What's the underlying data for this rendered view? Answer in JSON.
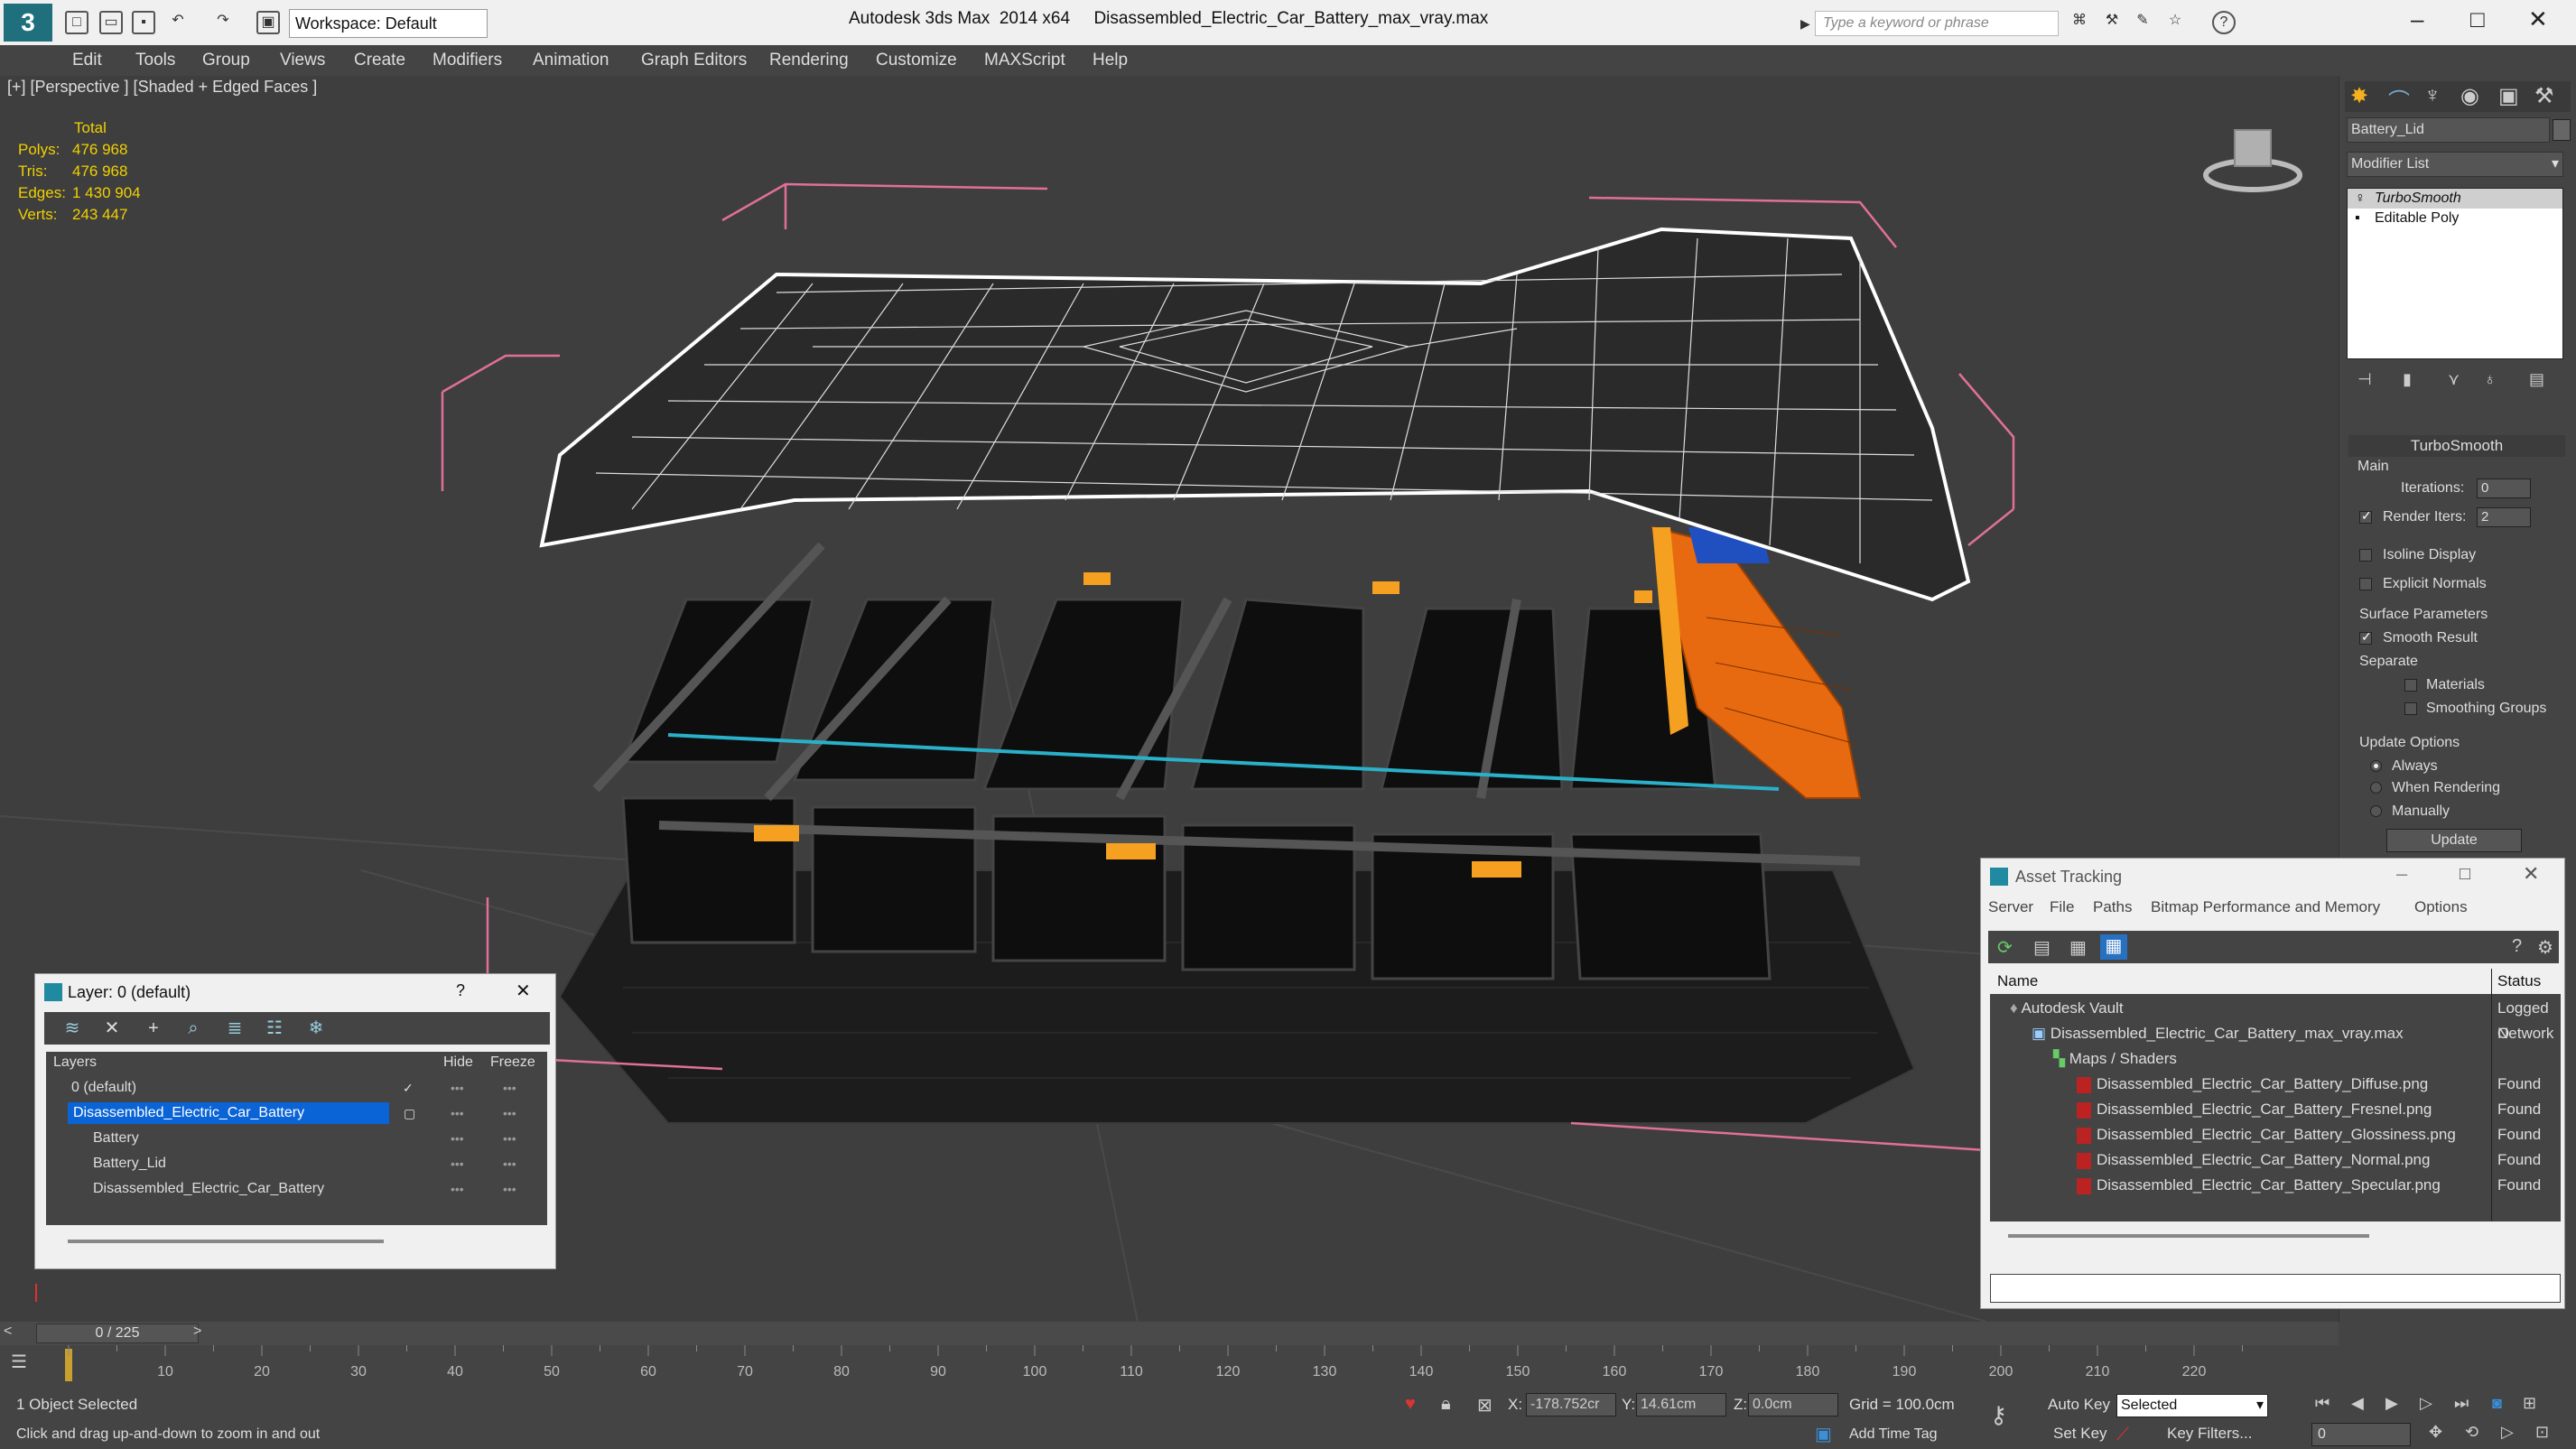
{
  "titlebar": {
    "app_logo": "3",
    "workspace": "Workspace: Default",
    "app_name": "Autodesk 3ds Max  2014 x64",
    "file_name": "Disassembled_Electric_Car_Battery_max_vray.max",
    "search_placeholder": "Type a keyword or phrase"
  },
  "menu": [
    "Edit",
    "Tools",
    "Group",
    "Views",
    "Create",
    "Modifiers",
    "Animation",
    "Graph Editors",
    "Rendering",
    "Customize",
    "MAXScript",
    "Help"
  ],
  "viewport": {
    "label": "[+] [Perspective ] [Shaded + Edged Faces ]",
    "stats": {
      "total_label": "Total",
      "polys_label": "Polys:",
      "polys": "476 968",
      "tris_label": "Tris:",
      "tris": "476 968",
      "edges_label": "Edges:",
      "edges": "1 430 904",
      "verts_label": "Verts:",
      "verts": "243 447"
    }
  },
  "command_panel": {
    "object_name": "Battery_Lid",
    "modifier_list": "Modifier List",
    "stack": [
      "TurboSmooth",
      "Editable Poly"
    ],
    "rollout_title": "TurboSmooth",
    "main_label": "Main",
    "iterations_label": "Iterations:",
    "iterations_value": "0",
    "render_iters_label": "Render Iters:",
    "render_iters_value": "2",
    "isoline_label": "Isoline Display",
    "explicit_normals_label": "Explicit Normals",
    "surface_params_label": "Surface Parameters",
    "smooth_result_label": "Smooth Result",
    "separate_label": "Separate",
    "materials_label": "Materials",
    "smoothing_groups_label": "Smoothing Groups",
    "update_options_label": "Update Options",
    "always_label": "Always",
    "when_rendering_label": "When Rendering",
    "manually_label": "Manually",
    "update_button": "Update"
  },
  "layer_dialog": {
    "title": "Layer: 0 (default)",
    "help": "?",
    "close": "✕",
    "col_layers": "Layers",
    "col_hide": "Hide",
    "col_freeze": "Freeze",
    "rows": [
      {
        "name": "0 (default)"
      },
      {
        "name": "Disassembled_Electric_Car_Battery"
      },
      {
        "name": "Battery"
      },
      {
        "name": "Battery_Lid"
      },
      {
        "name": "Disassembled_Electric_Car_Battery"
      }
    ]
  },
  "asset_dialog": {
    "title": "Asset Tracking",
    "menu": [
      "Server",
      "File",
      "Paths",
      "Bitmap Performance and Memory",
      "Options"
    ],
    "col_name": "Name",
    "col_status": "Status",
    "rows": [
      {
        "name": "Autodesk Vault",
        "status": "Logged O"
      },
      {
        "name": "Disassembled_Electric_Car_Battery_max_vray.max",
        "status": "Network"
      },
      {
        "name": "Maps / Shaders",
        "status": ""
      },
      {
        "name": "Disassembled_Electric_Car_Battery_Diffuse.png",
        "status": "Found"
      },
      {
        "name": "Disassembled_Electric_Car_Battery_Fresnel.png",
        "status": "Found"
      },
      {
        "name": "Disassembled_Electric_Car_Battery_Glossiness.png",
        "status": "Found"
      },
      {
        "name": "Disassembled_Electric_Car_Battery_Normal.png",
        "status": "Found"
      },
      {
        "name": "Disassembled_Electric_Car_Battery_Specular.png",
        "status": "Found"
      }
    ]
  },
  "timeline": {
    "frame_counter": "0 / 225",
    "ticks": [
      "10",
      "20",
      "30",
      "40",
      "50",
      "60",
      "70",
      "80",
      "90",
      "100",
      "110",
      "120",
      "130",
      "140",
      "150",
      "160",
      "170",
      "180",
      "190",
      "200",
      "210",
      "220"
    ]
  },
  "status": {
    "selection": "1 Object Selected",
    "prompt": "Click and drag up-and-down to zoom in and out",
    "x_label": "X:",
    "x_value": "-178.752cr",
    "y_label": "Y:",
    "y_value": "14.61cm",
    "z_label": "Z:",
    "z_value": "0.0cm",
    "grid": "Grid = 100.0cm",
    "auto_key": "Auto Key",
    "selected_dropdown": "Selected",
    "set_key": "Set Key",
    "key_filters": "Key Filters...",
    "add_time_tag": "Add Time Tag",
    "frame_value": "0"
  },
  "colors": {
    "wire_white": "#ffffff",
    "cell_orange": "#f5a020",
    "bms_orange": "#e86a10",
    "cable_cyan": "#2ab0c8",
    "bbox_pink": "#e0709a",
    "select_blue": "#0a64d6"
  }
}
